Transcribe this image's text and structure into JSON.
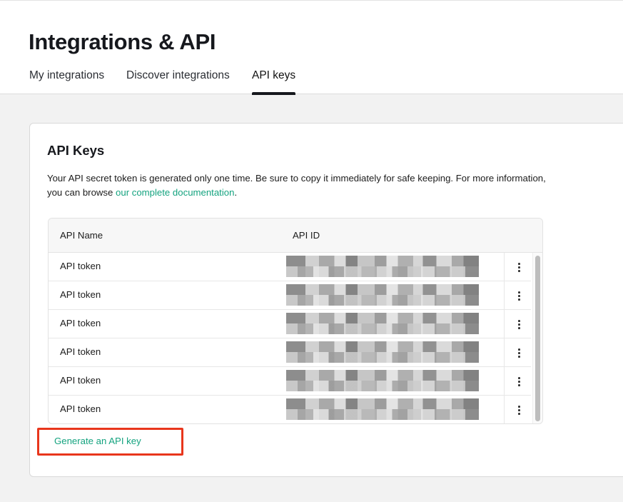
{
  "header": {
    "title": "Integrations & API",
    "tabs": [
      {
        "label": "My integrations"
      },
      {
        "label": "Discover integrations"
      },
      {
        "label": "API keys"
      }
    ]
  },
  "card": {
    "title": "API Keys",
    "description_pre": "Your API secret token is generated only one time. Be sure to copy it immediately for safe keeping. For more information, you can browse ",
    "description_link": "our complete documentation",
    "description_post": ".",
    "table": {
      "columns": [
        "API Name",
        "API ID"
      ],
      "rows": [
        {
          "name": "API token"
        },
        {
          "name": "API token"
        },
        {
          "name": "API token"
        },
        {
          "name": "API token"
        },
        {
          "name": "API token"
        },
        {
          "name": "API token"
        }
      ]
    },
    "generate_label": "Generate an API key"
  },
  "colors": {
    "accent": "#14a37f",
    "highlight": "#e8361c"
  },
  "icons": {
    "row_menu": "more-vertical-icon"
  }
}
